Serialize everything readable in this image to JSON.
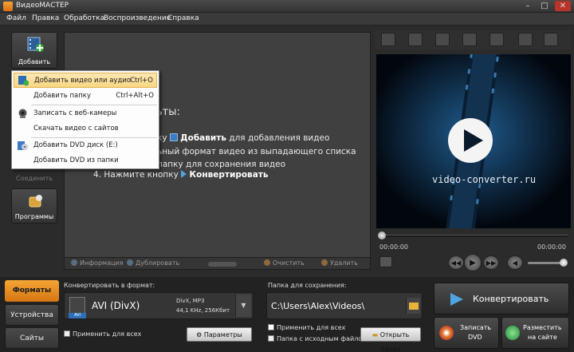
{
  "window": {
    "title": "ВидеоМАСТЕР",
    "minimize": "–",
    "maximize": "□",
    "close": "✕"
  },
  "menu": [
    "Файл",
    "Правка",
    "Обработка",
    "Воспроизведение",
    "Справка"
  ],
  "sidebar": {
    "add": "Добавить",
    "connect": "Соединить",
    "programs": "Программы"
  },
  "dropdown": {
    "items": [
      {
        "label": "Добавить видео или аудио",
        "shortcut": "Ctrl+O"
      },
      {
        "label": "Добавить папку",
        "shortcut": "Ctrl+Alt+O"
      },
      {
        "label": "Записать с веб-камеры",
        "shortcut": ""
      },
      {
        "label": "Скачать видео с сайтов",
        "shortcut": ""
      },
      {
        "label": "Добавить DVD диск (E:)",
        "shortcut": ""
      },
      {
        "label": "Добавить DVD из папки",
        "shortcut": ""
      }
    ]
  },
  "instructions": {
    "heading_tail": "ьты:",
    "line1_pre": "ку",
    "line1_bold": "Добавить",
    "line1_post": "для добавления видео",
    "line2": "ьный формат видео из выпадающего списка",
    "line3": "папку для сохранения видео",
    "line4_pre": "4. Нажмите кнопку",
    "line4_bold": "Конвертировать"
  },
  "list_toolbar": {
    "info": "Информация",
    "duplicate": "Дублировать",
    "clear": "Очистить",
    "delete": "Удалить"
  },
  "preview": {
    "watermark": "video-converter.ru",
    "time_left": "00:00:00",
    "time_right": "00:00:00"
  },
  "tabs": {
    "formats": "Форматы",
    "devices": "Устройства",
    "sites": "Сайты"
  },
  "format": {
    "caption": "Конвертировать в формат:",
    "name": "AVI (DivX)",
    "badge": "AVI",
    "codec": "DivX, MP3",
    "params": "44,1 KHz, 256Кбит",
    "apply_all": "Применить для всех",
    "settings_button": "Параметры"
  },
  "save": {
    "caption": "Папка для сохранения:",
    "path": "C:\\Users\\Alex\\Videos\\",
    "apply_all": "Применить для всех",
    "source_folder": "Папка с исходным файлом",
    "open_button": "Открыть папку"
  },
  "actions": {
    "convert": "Конвертировать",
    "burn_dvd_l1": "Записать",
    "burn_dvd_l2": "DVD",
    "publish_l1": "Разместить",
    "publish_l2": "на сайте"
  },
  "colors": {
    "accent": "#f09a2c",
    "highlight": "#f8d784",
    "background": "#2b2b2b"
  }
}
